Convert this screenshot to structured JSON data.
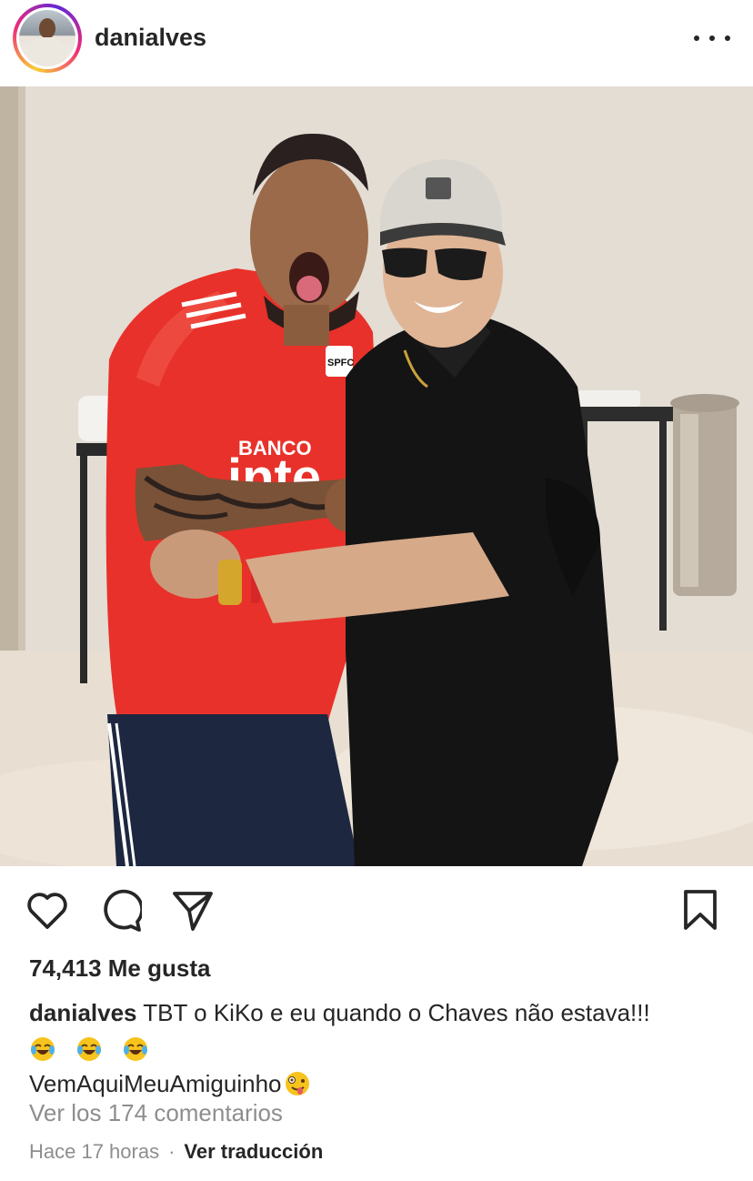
{
  "header": {
    "username": "danialves",
    "avatar_icon": "profile-avatar",
    "more_icon": "more-options-icon"
  },
  "post": {
    "image_icon": "post-photo"
  },
  "actions": {
    "like_icon": "heart-icon",
    "comment_icon": "comment-icon",
    "share_icon": "paper-plane-icon",
    "save_icon": "bookmark-icon"
  },
  "likes": "74,413 Me gusta",
  "caption": {
    "username": "danialves",
    "text": "TBT o KiKo e eu quando o Chaves não estava!!!",
    "emojis": [
      "face-with-tears-of-joy",
      "face-with-tears-of-joy",
      "face-with-tears-of-joy"
    ],
    "hashtag_line": "VemAquiMeuAmiguinho",
    "hashtag_emoji": "zany-face"
  },
  "view_comments": "Ver los 174 comentarios",
  "timestamp": "Hace 17 horas",
  "separator": "·",
  "translate": "Ver traducción",
  "colors": {
    "text": "#262626",
    "secondary": "#8e8e8e",
    "jersey_red": "#e8312a",
    "shirt_black": "#141414"
  }
}
